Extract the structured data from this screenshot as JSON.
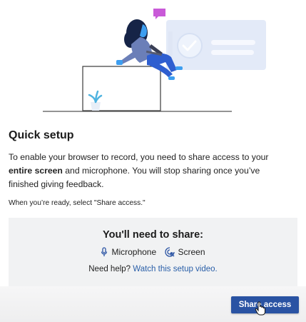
{
  "setup": {
    "title": "Quick setup",
    "intro_a": "To enable your browser to record, you need to share access to your ",
    "intro_bold": "entire screen",
    "intro_b": " and microphone. You will stop sharing once you’ve finished giving feedback.",
    "ready_note": "When you’re ready, select \"Share access.\""
  },
  "share": {
    "heading": "You'll need to share:",
    "items": [
      {
        "label": "Microphone",
        "icon": "microphone-icon"
      },
      {
        "label": "Screen",
        "icon": "screen-share-icon"
      }
    ],
    "help_prefix": "Need help?",
    "help_link": "Watch this setup video."
  },
  "actions": {
    "share_access": "Share access"
  },
  "colors": {
    "accent": "#2a53a3",
    "link": "#2a5fa8",
    "panel": "#f1f2f3"
  }
}
